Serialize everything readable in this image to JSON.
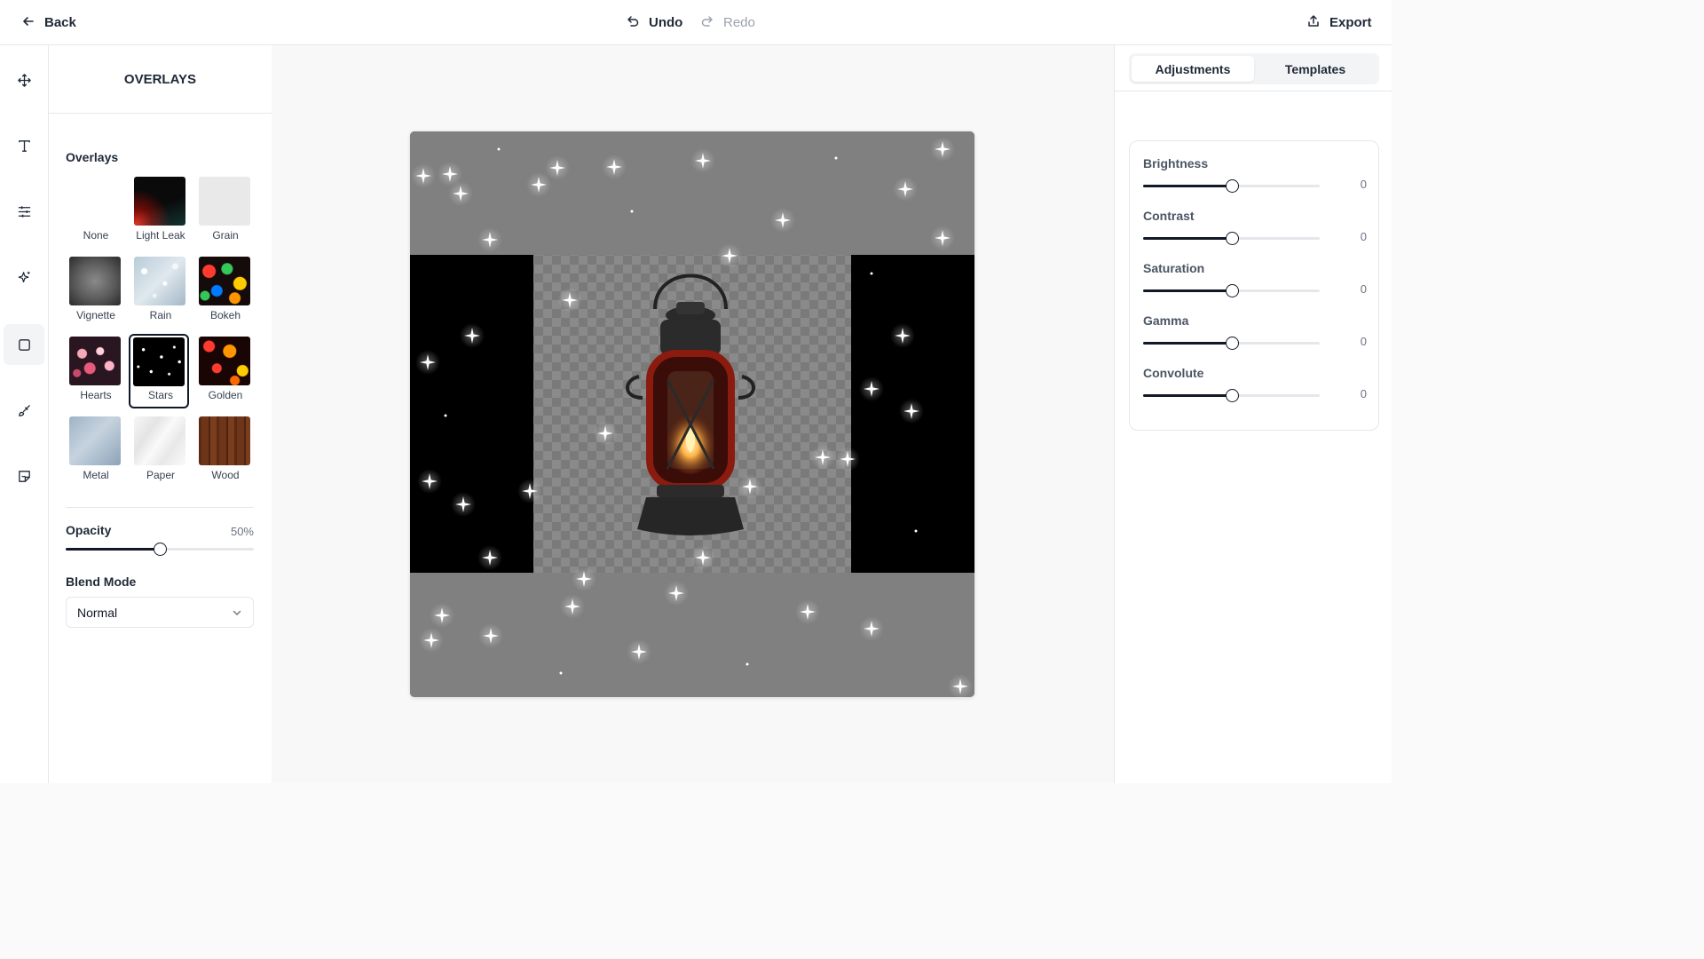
{
  "topbar": {
    "back_label": "Back",
    "undo_label": "Undo",
    "redo_label": "Redo",
    "export_label": "Export"
  },
  "rail": {
    "tools": [
      "move-icon",
      "text-icon",
      "sliders-icon",
      "sparkle-icon",
      "square-icon",
      "brush-icon",
      "sticker-icon"
    ],
    "active_tool": "square-icon"
  },
  "panel": {
    "title": "OVERLAYS",
    "overlays_label": "Overlays",
    "tiles": [
      {
        "label": "None"
      },
      {
        "label": "Light Leak"
      },
      {
        "label": "Grain"
      },
      {
        "label": "Vignette"
      },
      {
        "label": "Rain"
      },
      {
        "label": "Bokeh"
      },
      {
        "label": "Hearts"
      },
      {
        "label": "Stars"
      },
      {
        "label": "Golden"
      },
      {
        "label": "Metal"
      },
      {
        "label": "Paper"
      },
      {
        "label": "Wood"
      }
    ],
    "selected_tile": "Stars",
    "opacity_label": "Opacity",
    "opacity_value": "50%",
    "opacity_fraction": 0.5,
    "blend_label": "Blend Mode",
    "blend_value": "Normal"
  },
  "right_panel": {
    "tabs": [
      {
        "label": "Adjustments"
      },
      {
        "label": "Templates"
      }
    ],
    "active_tab": "Adjustments",
    "adjustments": [
      {
        "name": "Brightness",
        "value": "0",
        "fraction": 0.5
      },
      {
        "name": "Contrast",
        "value": "0",
        "fraction": 0.5
      },
      {
        "name": "Saturation",
        "value": "0",
        "fraction": 0.5
      },
      {
        "name": "Gamma",
        "value": "0",
        "fraction": 0.5
      },
      {
        "name": "Convolute",
        "value": "0",
        "fraction": 0.5
      }
    ]
  },
  "colors": {
    "accent": "#111827",
    "canvas_gray": "#808080",
    "lantern_red": "#8b1a0f",
    "flame": "#ffb347"
  }
}
